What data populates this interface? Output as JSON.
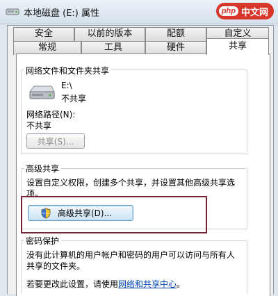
{
  "window": {
    "title": "本地磁盘 (E:) 属性"
  },
  "watermark": {
    "brand": "php",
    "site": "中文网"
  },
  "tabs": {
    "row_back": [
      {
        "label": "安全"
      },
      {
        "label": "以前的版本"
      },
      {
        "label": "配额"
      },
      {
        "label": "自定义"
      }
    ],
    "row_front": [
      {
        "label": "常规"
      },
      {
        "label": "工具"
      },
      {
        "label": "硬件"
      },
      {
        "label": "共享",
        "active": true
      }
    ]
  },
  "network_sharing": {
    "title": "网络文件和文件夹共享",
    "path": "E:\\",
    "status": "不共享",
    "network_path_label": "网络路径(N):",
    "network_path_value": "不共享",
    "share_button": "共享(S)..."
  },
  "advanced_sharing": {
    "title": "高级共享",
    "description_line1": "设置自定义权限，创建多个共享，并设置其他高级共享选",
    "description_line2": "项。",
    "button": "高级共享(D)..."
  },
  "password_protection": {
    "title": "密码保护",
    "description_line1": "没有此计算机的用户帐户和密码的用户可以访问与所有人",
    "description_line2": "共享的文件夹。",
    "change_prefix": "若要更改此设置，请使用",
    "change_link": "网络和共享中心",
    "change_suffix": "。"
  }
}
